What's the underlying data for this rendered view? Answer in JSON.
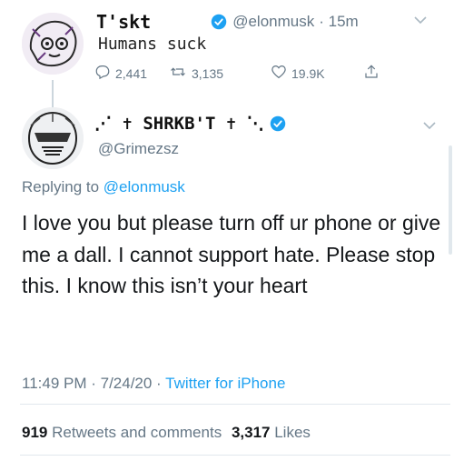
{
  "tweet1": {
    "display_name": "T'skt",
    "handle": "@elonmusk",
    "time": "· 15m",
    "text": "Humans suck",
    "replies": "2,441",
    "retweets": "3,135",
    "likes": "19.9K"
  },
  "tweet2": {
    "display_name": "⋰ ✝ SHRKB'T ✝ ⋱",
    "handle": "@Grimezsz",
    "replying_prefix": "Replying to",
    "replying_to": "@elonmusk",
    "text": "I love you but please turn off ur phone or give me a dall.  I cannot support hate.  Please stop this. I know this isn’t your heart",
    "timestamp": "11:49 PM · 7/24/20 ·",
    "source": "Twitter for iPhone",
    "retweets_count": "919",
    "retweets_label": "Retweets and comments",
    "likes_count": "3,317",
    "likes_label": "Likes"
  },
  "colors": {
    "accent": "#1da1f2",
    "muted": "#657786",
    "border": "#e1e8ed"
  },
  "icons": [
    "reply-icon",
    "retweet-icon",
    "like-icon",
    "share-icon",
    "verified-badge-icon",
    "chevron-down-icon"
  ]
}
